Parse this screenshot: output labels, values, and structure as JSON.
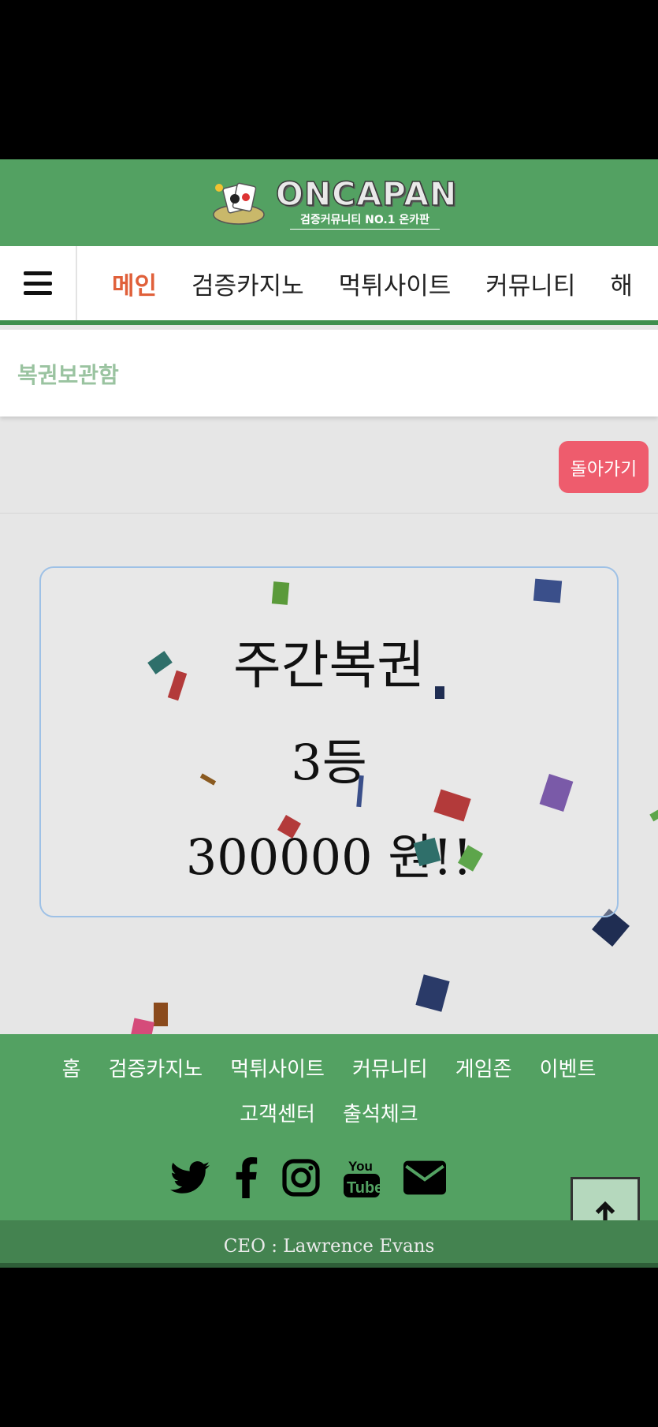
{
  "header": {
    "logo_title": "ONCAPAN",
    "logo_subtitle": "검증커뮤니티 NO.1 온카판"
  },
  "nav": {
    "menu_icon": "hamburger-menu-icon",
    "items": [
      {
        "label": "메인",
        "active": true
      },
      {
        "label": "검증카지노"
      },
      {
        "label": "먹튀사이트"
      },
      {
        "label": "커뮤니티"
      },
      {
        "label": "해"
      }
    ]
  },
  "breadcrumb": {
    "label": "복권보관함"
  },
  "back_button": {
    "label": "돌아가기"
  },
  "prize": {
    "title": "주간복권",
    "rank": "3등",
    "amount": "300000 원!!"
  },
  "footer": {
    "links": [
      "홈",
      "검증카지노",
      "먹튀사이트",
      "커뮤니티",
      "게임존",
      "이벤트",
      "고객센터",
      "출석체크"
    ],
    "social_icons": [
      "twitter-icon",
      "facebook-icon",
      "instagram-icon",
      "youtube-icon",
      "email-icon"
    ],
    "ceo": "CEO : Lawrence Evans"
  },
  "scroll_top": {
    "icon": "arrow-up-icon"
  },
  "colors": {
    "brand_green": "#53a162",
    "active_nav": "#e0603a",
    "back_button": "#ee5c6d"
  }
}
